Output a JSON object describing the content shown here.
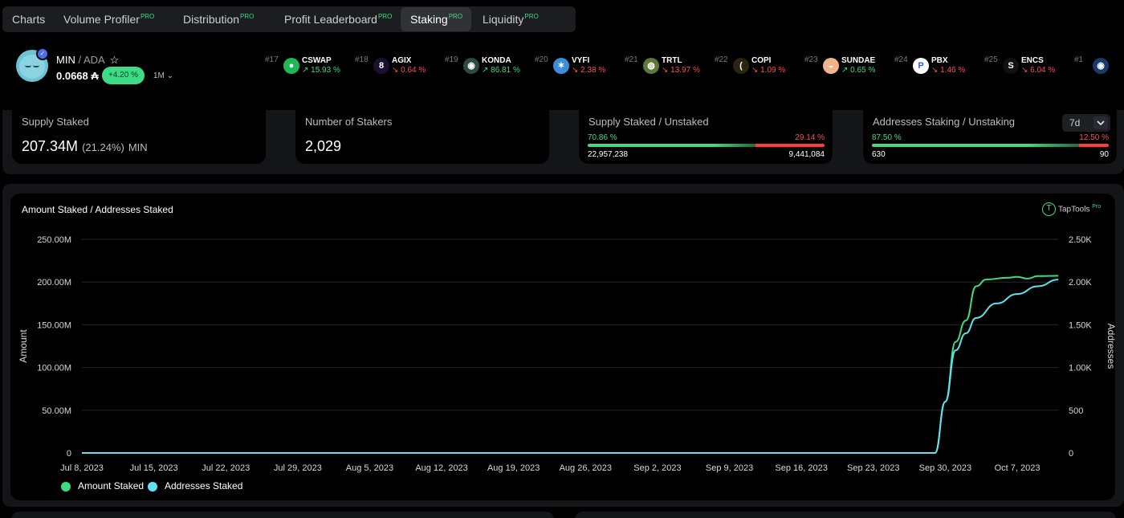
{
  "tabs": [
    {
      "label": "Charts",
      "pro": ""
    },
    {
      "label": "Volume Profiler",
      "pro": "PRO"
    },
    {
      "label": "Distribution",
      "pro": "PRO"
    },
    {
      "label": "Profit Leaderboard",
      "pro": "PRO"
    },
    {
      "label": "Staking",
      "pro": "PRO"
    },
    {
      "label": "Liquidity",
      "pro": "PRO"
    }
  ],
  "token": {
    "symbol": "MIN",
    "quote": "/ ADA",
    "price": "0.0668 ₳",
    "change": "+4.20 %",
    "period": "1M ⌄"
  },
  "ticker": [
    {
      "rank": "#17",
      "symbol": "CSWAP",
      "change": "↗ 15.93 %",
      "dir": "up",
      "logo_color": "#1db954"
    },
    {
      "rank": "#18",
      "symbol": "AGIX",
      "change": "↘ 0.64 %",
      "dir": "down",
      "logo_color": "#1a1030"
    },
    {
      "rank": "#19",
      "symbol": "KONDA",
      "change": "↗ 86.81 %",
      "dir": "up",
      "logo_color": "#2f4a40"
    },
    {
      "rank": "#20",
      "symbol": "VYFI",
      "change": "↘ 2.38 %",
      "dir": "down",
      "logo_color": "#3a8fd8"
    },
    {
      "rank": "#21",
      "symbol": "TRTL",
      "change": "↘ 13.97 %",
      "dir": "down",
      "logo_color": "#5b7a3a"
    },
    {
      "rank": "#22",
      "symbol": "COPI",
      "change": "↘ 1.09 %",
      "dir": "down",
      "logo_color": "#2a2410"
    },
    {
      "rank": "#23",
      "symbol": "SUNDAE",
      "change": "↗ 0.65 %",
      "dir": "up",
      "logo_color": "#f2b48a"
    },
    {
      "rank": "#24",
      "symbol": "PBX",
      "change": "↘ 1.46 %",
      "dir": "down",
      "logo_color": "#ffffff"
    },
    {
      "rank": "#25",
      "symbol": "ENCS",
      "change": "↘ 6.04 %",
      "dir": "down",
      "logo_color": "#111111"
    },
    {
      "rank": "#1",
      "symbol": "",
      "change": "",
      "dir": "up",
      "logo_color": "#1a3a6a"
    }
  ],
  "stats": {
    "supply_staked": {
      "label": "Supply Staked",
      "value": "207.34M",
      "pct": "(21.24%)",
      "unit": "MIN"
    },
    "stakers": {
      "label": "Number of Stakers",
      "value": "2,029"
    },
    "supply_split": {
      "label": "Supply Staked / Unstaked",
      "staked_pct": "70.86 %",
      "unstaked_pct": "29.14 %",
      "staked": "22,957,238",
      "unstaked": "9,441,084",
      "fraction": 0.7086
    },
    "address_split": {
      "label": "Addresses Staking / Unstaking",
      "staking_pct": "87.50 %",
      "unstaking_pct": "12.50 %",
      "staking": "630",
      "unstaking": "90",
      "fraction": 0.875,
      "period": "7d"
    }
  },
  "chart_title": "Amount Staked / Addresses Staked",
  "brand": {
    "name": "TapTools",
    "tier": "Pro",
    "color": "#3ddc84"
  },
  "chart_data": {
    "type": "line",
    "ylabel": "Amount",
    "y2label": "Addresses",
    "ylim": [
      0,
      250000000
    ],
    "y2lim": [
      0,
      2500
    ],
    "y_ticks": [
      "0",
      "50.00M",
      "100.00M",
      "150.00M",
      "200.00M",
      "250.00M"
    ],
    "y2_ticks": [
      "0",
      "500",
      "1.00K",
      "1.50K",
      "2.00K",
      "2.50K"
    ],
    "x_ticks": [
      "Jul 8, 2023",
      "Jul 15, 2023",
      "Jul 22, 2023",
      "Jul 29, 2023",
      "Aug 5, 2023",
      "Aug 12, 2023",
      "Aug 19, 2023",
      "Aug 26, 2023",
      "Sep 2, 2023",
      "Sep 9, 2023",
      "Sep 16, 2023",
      "Sep 23, 2023",
      "Sep 30, 2023",
      "Oct 7, 2023"
    ],
    "grid": true,
    "series": [
      {
        "name": "Amount Staked",
        "color": "#3ddc84",
        "axis": "left",
        "points": [
          [
            "2023-07-08",
            0
          ],
          [
            "2023-09-29",
            0
          ],
          [
            "2023-09-30",
            60000000
          ],
          [
            "2023-10-01",
            130000000
          ],
          [
            "2023-10-02",
            155000000
          ],
          [
            "2023-10-03",
            195000000
          ],
          [
            "2023-10-04",
            203000000
          ],
          [
            "2023-10-06",
            205000000
          ],
          [
            "2023-10-07",
            206000000
          ],
          [
            "2023-10-08",
            204000000
          ],
          [
            "2023-10-09",
            207000000
          ],
          [
            "2023-10-11",
            207340000
          ]
        ]
      },
      {
        "name": "Addresses Staked",
        "color": "#5ee3f0",
        "axis": "right",
        "points": [
          [
            "2023-07-08",
            0
          ],
          [
            "2023-09-29",
            0
          ],
          [
            "2023-09-30",
            600
          ],
          [
            "2023-10-01",
            1200
          ],
          [
            "2023-10-02",
            1400
          ],
          [
            "2023-10-03",
            1580
          ],
          [
            "2023-10-05",
            1750
          ],
          [
            "2023-10-07",
            1860
          ],
          [
            "2023-10-09",
            1950
          ],
          [
            "2023-10-11",
            2029
          ]
        ]
      }
    ]
  }
}
